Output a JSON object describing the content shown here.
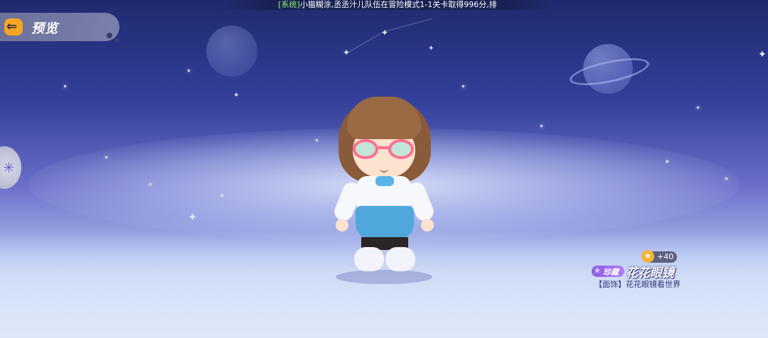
{
  "ticker": {
    "tag": "[系统]",
    "message": "小猫糊涂,丞丞汁儿队伍在冒险模式1-1关卡取得996分,排"
  },
  "header": {
    "back_icon": "back-arrow-icon",
    "title": "预览"
  },
  "side_tab": {
    "icon": "pinwheel-icon"
  },
  "item": {
    "score": "+40",
    "score_icon": "star-coin-icon",
    "rarity": "珍藏",
    "rarity_color": "#9b6cf0",
    "name": "花花眼镜",
    "description": "【面饰】花花眼镜看世界"
  },
  "colors": {
    "accent": "#f5a623",
    "ticker_tag": "#8df06a"
  }
}
